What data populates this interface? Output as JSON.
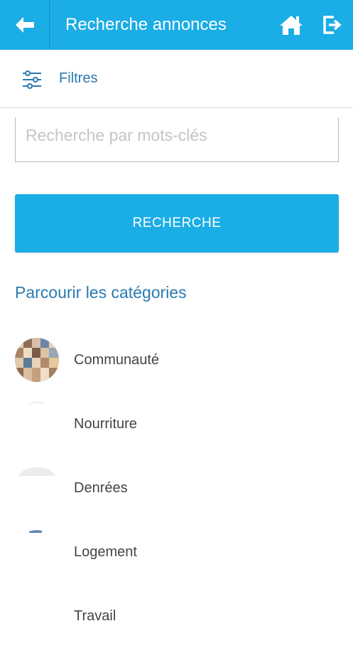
{
  "header": {
    "title": "Recherche annonces",
    "back_icon": "arrow-left-icon",
    "home_icon": "home-icon",
    "logout_icon": "logout-icon",
    "bar_color": "#1aade6"
  },
  "filters": {
    "label": "Filtres",
    "icon": "sliders-icon"
  },
  "search": {
    "placeholder": "Recherche par mots-clés",
    "value": "",
    "button_label": "RECHERCHE"
  },
  "categories": {
    "title": "Parcourir les catégories",
    "items": [
      {
        "label": "Communauté"
      },
      {
        "label": "Nourriture"
      },
      {
        "label": "Denrées"
      },
      {
        "label": "Logement"
      },
      {
        "label": "Travail"
      }
    ]
  },
  "colors": {
    "accent": "#1aade6",
    "link_text": "#2a7ab0",
    "body_text": "#444444"
  }
}
